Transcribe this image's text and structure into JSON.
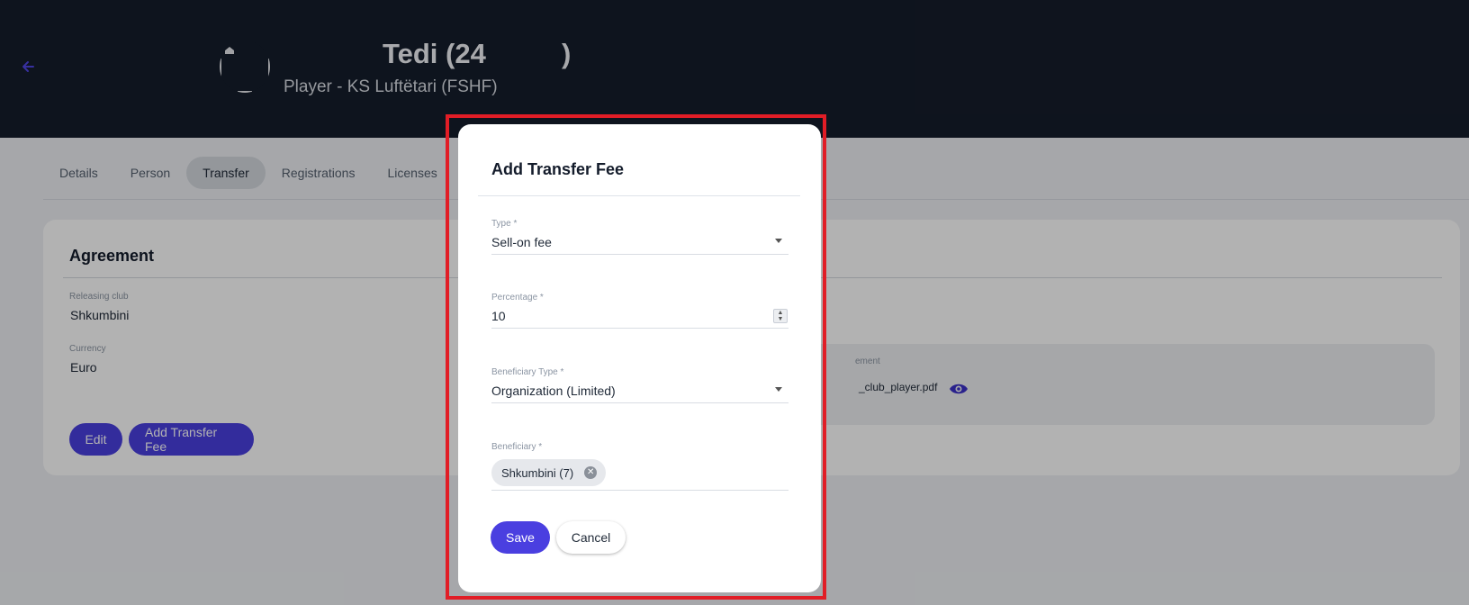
{
  "header": {
    "player_name_part1": "Tedi (24",
    "player_name_part2": ")",
    "subtitle": "Player - KS Luftëtari (FSHF)"
  },
  "tabs": [
    {
      "label": "Details",
      "active": false
    },
    {
      "label": "Person",
      "active": false
    },
    {
      "label": "Transfer",
      "active": true
    },
    {
      "label": "Registrations",
      "active": false
    },
    {
      "label": "Licenses",
      "active": false
    }
  ],
  "agreement": {
    "title": "Agreement",
    "releasing_club_label": "Releasing club",
    "releasing_club_value": "Shkumbini",
    "currency_label": "Currency",
    "currency_value": "Euro",
    "document_label_fragment": "ement",
    "document_file_fragment": "_club_player.pdf",
    "edit_button": "Edit",
    "add_fee_button": "Add Transfer Fee"
  },
  "modal": {
    "title": "Add Transfer Fee",
    "type_label": "Type *",
    "type_value": "Sell-on fee",
    "percentage_label": "Percentage *",
    "percentage_value": "10",
    "beneficiary_type_label": "Beneficiary Type *",
    "beneficiary_type_value": "Organization (Limited)",
    "beneficiary_label": "Beneficiary *",
    "beneficiary_chip": "Shkumbini (7)",
    "save_button": "Save",
    "cancel_button": "Cancel"
  },
  "colors": {
    "header_bg": "#151d2b",
    "primary": "#4a3fe0",
    "highlight": "#e11d26"
  }
}
